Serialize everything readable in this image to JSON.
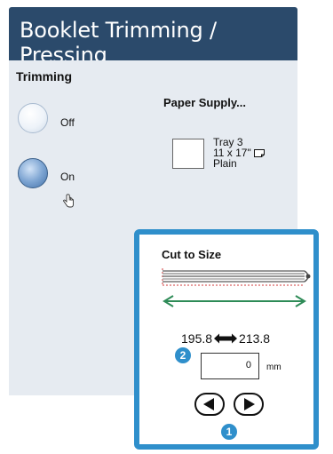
{
  "window": {
    "title": "Booklet Trimming / Pressing"
  },
  "trimming": {
    "label": "Trimming",
    "options": [
      {
        "label": "Off",
        "selected": false
      },
      {
        "label": "On",
        "selected": true
      }
    ]
  },
  "paper_supply": {
    "button_label": "Paper Supply...",
    "tray": "Tray 3",
    "size": "11 x 17\"",
    "type": "Plain",
    "orientation_icon": "paper-sef-icon"
  },
  "cut_to_size": {
    "title": "Cut to Size",
    "range_min": "195.8",
    "range_max": "213.8",
    "value": "0",
    "unit": "mm",
    "callout_value_field": "2",
    "callout_panel": "1",
    "icons": [
      "booklet-trim-graphic",
      "double-arrow-icon",
      "decrement-arrow-icon",
      "increment-arrow-icon",
      "hand-cursor-icon"
    ]
  },
  "colors": {
    "title_bar": "#2b4a6b",
    "panel_bg": "#e6ebf1",
    "callout_blue": "#2f8fcb",
    "dimension_green": "#2e8b57",
    "trim_red": "#d23a3a"
  }
}
